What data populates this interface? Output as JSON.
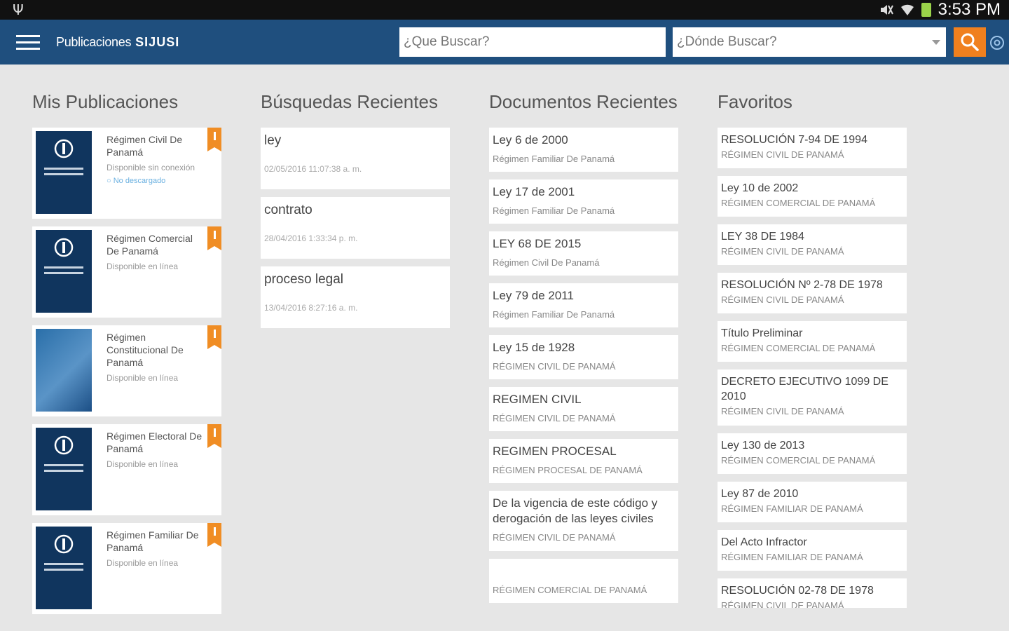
{
  "status_bar": {
    "time": "3:53 PM"
  },
  "app": {
    "title": "Publicaciones",
    "title_suffix": "SIJUSI",
    "search_placeholder": "¿Que Buscar?",
    "where_placeholder": "¿Dónde Buscar?",
    "accent": "#f0801e",
    "bar_color": "#1f4f7e"
  },
  "sections": {
    "publications": "Mis Publicaciones",
    "searches": "Búsquedas Recientes",
    "documents": "Documentos Recientes",
    "favorites": "Favoritos"
  },
  "publications": [
    {
      "title": "Régimen Civil De Panamá",
      "status": "Disponible sin conexión",
      "sub": "○ No descargado"
    },
    {
      "title": "Régimen Comercial De Panamá",
      "status": "Disponible en línea",
      "sub": ""
    },
    {
      "title": "Régimen Constitucional De Panamá",
      "status": "Disponible en línea",
      "sub": ""
    },
    {
      "title": "Régimen Electoral De Panamá",
      "status": "Disponible en línea",
      "sub": ""
    },
    {
      "title": "Régimen Familiar De Panamá",
      "status": "Disponible en línea",
      "sub": ""
    }
  ],
  "searches": [
    {
      "term": "ley",
      "date": "02/05/2016 11:07:38 a. m."
    },
    {
      "term": "contrato",
      "date": "28/04/2016 1:33:34 p. m."
    },
    {
      "term": "proceso legal",
      "date": "13/04/2016 8:27:16 a. m."
    }
  ],
  "documents": [
    {
      "title": "Ley 6 de 2000",
      "source": "Régimen Familiar De Panamá"
    },
    {
      "title": "Ley 17 de 2001",
      "source": "Régimen Familiar De Panamá"
    },
    {
      "title": "LEY 68 DE 2015",
      "source": "Régimen Civil De Panamá"
    },
    {
      "title": "Ley 79 de 2011",
      "source": "Régimen Familiar De Panamá"
    },
    {
      "title": "Ley 15 de 1928",
      "source": "RÉGIMEN CIVIL DE PANAMÁ"
    },
    {
      "title": "REGIMEN CIVIL",
      "source": "RÉGIMEN CIVIL DE PANAMÁ"
    },
    {
      "title": "REGIMEN PROCESAL",
      "source": "RÉGIMEN PROCESAL DE PANAMÁ"
    },
    {
      "title": "De la vigencia de este código y derogación de las leyes civiles",
      "source": "RÉGIMEN CIVIL DE PANAMÁ"
    },
    {
      "title": "",
      "source": "RÉGIMEN COMERCIAL DE PANAMÁ"
    }
  ],
  "favorites": [
    {
      "title": "RESOLUCIÓN 7-94 DE 1994",
      "source": "RÉGIMEN CIVIL DE PANAMÁ"
    },
    {
      "title": "Ley 10 de 2002",
      "source": "RÉGIMEN COMERCIAL DE PANAMÁ"
    },
    {
      "title": "LEY 38 DE 1984",
      "source": "RÉGIMEN CIVIL DE PANAMÁ"
    },
    {
      "title": "RESOLUCIÓN Nº 2-78 DE 1978",
      "source": "RÉGIMEN CIVIL DE PANAMÁ"
    },
    {
      "title": "Título Preliminar",
      "source": "RÉGIMEN COMERCIAL DE PANAMÁ"
    },
    {
      "title": "DECRETO EJECUTIVO 1099 DE 2010",
      "source": "RÉGIMEN CIVIL DE PANAMÁ"
    },
    {
      "title": "Ley 130 de 2013",
      "source": "RÉGIMEN COMERCIAL DE PANAMÁ"
    },
    {
      "title": "Ley 87 de 2010",
      "source": "RÉGIMEN FAMILIAR DE PANAMÁ"
    },
    {
      "title": "Del Acto Infractor",
      "source": "RÉGIMEN FAMILIAR DE PANAMÁ"
    },
    {
      "title": "RESOLUCIÓN 02-78 DE 1978",
      "source": "RÉGIMEN CIVIL DE PANAMÁ"
    }
  ]
}
